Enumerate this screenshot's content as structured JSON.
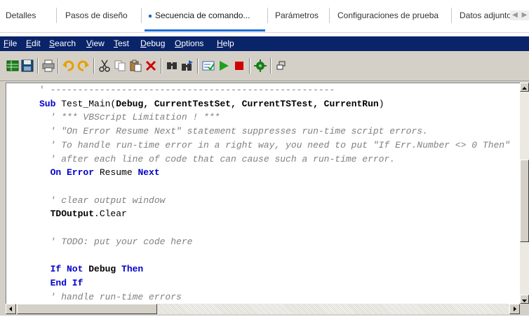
{
  "tabs": [
    {
      "label": "Detalles",
      "active": false
    },
    {
      "label": "Pasos de diseño",
      "active": false
    },
    {
      "label": "Secuencia de comando...",
      "active": true
    },
    {
      "label": "Parámetros",
      "active": false
    },
    {
      "label": "Configuraciones de prueba",
      "active": false
    },
    {
      "label": "Datos adjuntos",
      "active": false
    }
  ],
  "menu": [
    {
      "label": "File",
      "mnemonic": "F"
    },
    {
      "label": "Edit",
      "mnemonic": "E"
    },
    {
      "label": "Search",
      "mnemonic": "S"
    },
    {
      "label": "View",
      "mnemonic": "V"
    },
    {
      "label": "Test",
      "mnemonic": "T"
    },
    {
      "label": "Debug",
      "mnemonic": "D"
    },
    {
      "label": "Options",
      "mnemonic": "O"
    },
    {
      "label": "Help",
      "mnemonic": "H"
    }
  ],
  "toolbar": {
    "buttons": [
      "grid-icon",
      "save-icon",
      "print-icon",
      "undo-icon",
      "redo-icon",
      "cut-icon",
      "copy-icon",
      "paste-icon",
      "delete-icon",
      "find-icon",
      "find-next-icon",
      "syntax-check-icon",
      "run-icon",
      "stop-icon",
      "reference-icon",
      "object-browser-icon"
    ]
  },
  "code": {
    "lines": [
      [
        {
          "t": "' ----------------------------------------------------",
          "c": "cmline"
        }
      ],
      [
        {
          "t": "Sub ",
          "c": "kw"
        },
        {
          "t": "Test_Main(",
          "c": ""
        },
        {
          "t": "Debug, CurrentTestSet, CurrentTSTest, CurrentRun",
          "c": "bd"
        },
        {
          "t": ")",
          "c": ""
        }
      ],
      [
        {
          "t": "  ' *** VBScript Limitation ! ***",
          "c": "cm"
        }
      ],
      [
        {
          "t": "  ' \"On Error Resume Next\" statement suppresses run-time script errors.",
          "c": "cm"
        }
      ],
      [
        {
          "t": "  ' To handle run-time error in a right way, you need to put \"If Err.Number <> 0 Then\"",
          "c": "cm"
        }
      ],
      [
        {
          "t": "  ' after each line of code that can cause such a run-time error.",
          "c": "cm"
        }
      ],
      [
        {
          "t": "  On Error ",
          "c": "kw"
        },
        {
          "t": "Resume ",
          "c": ""
        },
        {
          "t": "Next",
          "c": "kw"
        }
      ],
      [
        {
          "t": "",
          "c": ""
        }
      ],
      [
        {
          "t": "  ' clear output window",
          "c": "cm"
        }
      ],
      [
        {
          "t": "  TDOutput",
          "c": "bd"
        },
        {
          "t": ".Clear",
          "c": ""
        }
      ],
      [
        {
          "t": "",
          "c": ""
        }
      ],
      [
        {
          "t": "  ' TODO: put your code here",
          "c": "cm"
        }
      ],
      [
        {
          "t": "",
          "c": ""
        }
      ],
      [
        {
          "t": "  If Not ",
          "c": "kw"
        },
        {
          "t": "Debug ",
          "c": "bd"
        },
        {
          "t": "Then",
          "c": "kw"
        }
      ],
      [
        {
          "t": "  End If",
          "c": "kw"
        }
      ],
      [
        {
          "t": "  ' handle run-time errors",
          "c": "cm"
        }
      ]
    ]
  },
  "colors": {
    "menubar_bg": "#0a246a",
    "tab_accent": "#1e6fd8",
    "keyword": "#0000cc",
    "comment": "#808080"
  }
}
